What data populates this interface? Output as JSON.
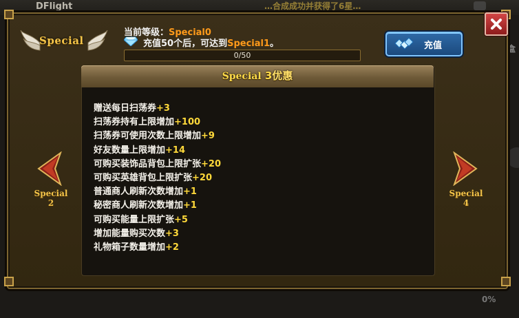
{
  "background": {
    "top_left_text": "DFlight",
    "top_right_text": "…合成成功并获得了6星…",
    "right_edge_text": "盒",
    "bottom_right_text": "0%"
  },
  "header": {
    "logo_text": "Special",
    "level_label": "当前等级：",
    "level_value": "Special0",
    "tip_prefix": "充值50个后，可达到",
    "tip_target": "Special1",
    "tip_suffix": "。",
    "progress_text": "0/50",
    "progress_fraction": 0.0,
    "recharge_label": "充值"
  },
  "card": {
    "title_special": "Special",
    "title_level": "3",
    "title_suffix": "优惠",
    "perks": [
      {
        "text": "赠送每日扫荡券",
        "bonus": "+3"
      },
      {
        "text": "扫荡券持有上限增加",
        "bonus": "+100"
      },
      {
        "text": "扫荡券可使用次数上限增加",
        "bonus": "+9"
      },
      {
        "text": "好友数量上限增加",
        "bonus": "+14"
      },
      {
        "text": "可购买装饰品背包上限扩张",
        "bonus": "+20"
      },
      {
        "text": "可购买英雄背包上限扩张",
        "bonus": "+20"
      },
      {
        "text": "普通商人刷新次数增加",
        "bonus": "+1"
      },
      {
        "text": "秘密商人刷新次数增加",
        "bonus": "+1"
      },
      {
        "text": "可购买能量上限扩张",
        "bonus": "+5"
      },
      {
        "text": "增加能量购买次数",
        "bonus": "+3"
      },
      {
        "text": "礼物箱子数量增加",
        "bonus": "+2"
      }
    ]
  },
  "nav": {
    "prev_label": "Special",
    "prev_level": "2",
    "next_label": "Special",
    "next_level": "4"
  },
  "icons": {
    "logo": "winged-badge-icon",
    "gem": "diamond-icon",
    "recharge": "gem-pile-icon",
    "close": "close-icon",
    "prev": "arrow-left-icon",
    "next": "arrow-right-icon"
  },
  "colors": {
    "highlight_orange": "#ff9a1a",
    "bonus_yellow": "#ffd93a",
    "title_gold": "#ffdb4a",
    "close_red": "#d24545",
    "recharge_blue": "#2f6aa6"
  }
}
